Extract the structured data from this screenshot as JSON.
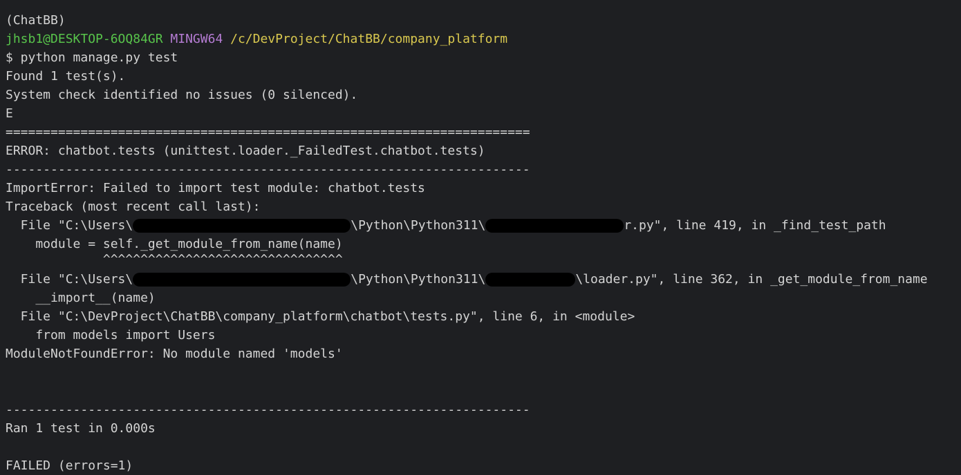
{
  "terminal": {
    "line_top": "",
    "env_line": "(ChatBB)",
    "prompt_user": "jhsb1@DESKTOP-6OQ84GR",
    "prompt_shell": "MINGW64",
    "prompt_path": "/c/DevProject/ChatBB/company_platform",
    "command": "$ python manage.py test",
    "found": "Found 1 test(s).",
    "system_check": "System check identified no issues (0 silenced).",
    "e_marker": "E",
    "sep_eq": "======================================================================",
    "error_header": "ERROR: chatbot.tests (unittest.loader._FailedTest.chatbot.tests)",
    "sep_dash": "----------------------------------------------------------------------",
    "import_error": "ImportError: Failed to import test module: chatbot.tests",
    "traceback": "Traceback (most recent call last):",
    "tb1_prefix": "  File \"C:\\Users\\",
    "tb1_mid": "\\Python\\Python311\\",
    "tb1_suffix": "r.py\", line 419, in _find_test_path",
    "tb1_code": "    module = self._get_module_from_name(name)",
    "tb1_carets": "             ^^^^^^^^^^^^^^^^^^^^^^^^^^^^^^^^",
    "tb2_prefix": "  File \"C:\\Users\\",
    "tb2_mid": "\\Python\\Python311\\",
    "tb2_suffix": "\\loader.py\", line 362, in _get_module_from_name",
    "tb2_code": "    __import__(name)",
    "tb3": "  File \"C:\\DevProject\\ChatBB\\company_platform\\chatbot\\tests.py\", line 6, in <module>",
    "tb3_code": "    from models import Users",
    "module_error": "ModuleNotFoundError: No module named 'models'",
    "ran": "Ran 1 test in 0.000s",
    "failed": "FAILED (errors=1)"
  }
}
